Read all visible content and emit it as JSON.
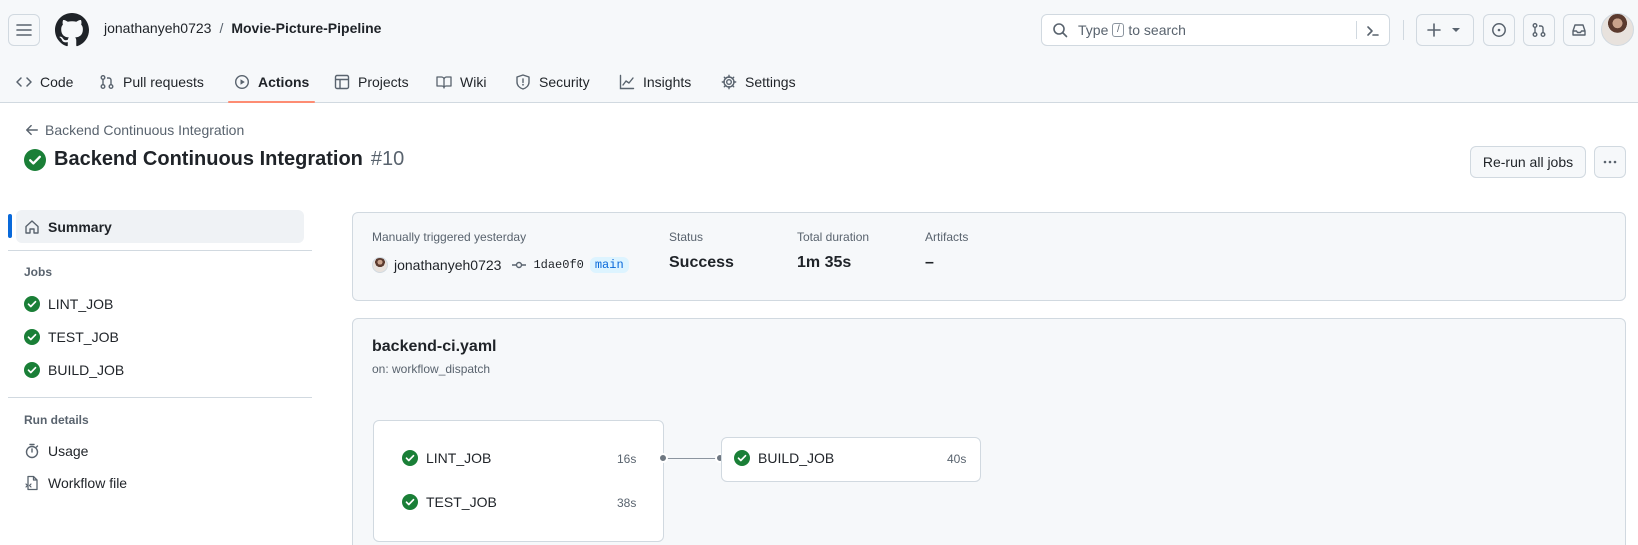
{
  "header": {
    "owner": "jonathanyeh0723",
    "separator": "/",
    "repo": "Movie-Picture-Pipeline",
    "search_prefix": "Type",
    "search_key": "/",
    "search_suffix": "to search"
  },
  "tabs": [
    {
      "label": "Code",
      "icon": "code-icon"
    },
    {
      "label": "Pull requests",
      "icon": "git-pull-request-icon"
    },
    {
      "label": "Actions",
      "icon": "play-icon",
      "active": true
    },
    {
      "label": "Projects",
      "icon": "table-icon"
    },
    {
      "label": "Wiki",
      "icon": "book-icon"
    },
    {
      "label": "Security",
      "icon": "shield-icon"
    },
    {
      "label": "Insights",
      "icon": "graph-icon"
    },
    {
      "label": "Settings",
      "icon": "gear-icon"
    }
  ],
  "run": {
    "back_label": "Backend Continuous Integration",
    "title": "Backend Continuous Integration",
    "number": "#10",
    "rerun_label": "Re-run all jobs",
    "status_color": "#1a7f37"
  },
  "sidebar": {
    "summary_label": "Summary",
    "jobs_heading": "Jobs",
    "jobs": [
      "LINT_JOB",
      "TEST_JOB",
      "BUILD_JOB"
    ],
    "run_details_heading": "Run details",
    "usage_label": "Usage",
    "workflow_file_label": "Workflow file"
  },
  "summary": {
    "trigger_label": "Manually triggered yesterday",
    "actor": "jonathanyeh0723",
    "commit_sha": "1dae0f0",
    "branch": "main",
    "status_label": "Status",
    "status_value": "Success",
    "duration_label": "Total duration",
    "duration_value": "1m 35s",
    "artifacts_label": "Artifacts",
    "artifacts_value": "–"
  },
  "workflow": {
    "file_name": "backend-ci.yaml",
    "trigger": "on: workflow_dispatch",
    "jobs": [
      {
        "name": "LINT_JOB",
        "duration": "16s"
      },
      {
        "name": "TEST_JOB",
        "duration": "38s"
      },
      {
        "name": "BUILD_JOB",
        "duration": "40s"
      }
    ]
  }
}
